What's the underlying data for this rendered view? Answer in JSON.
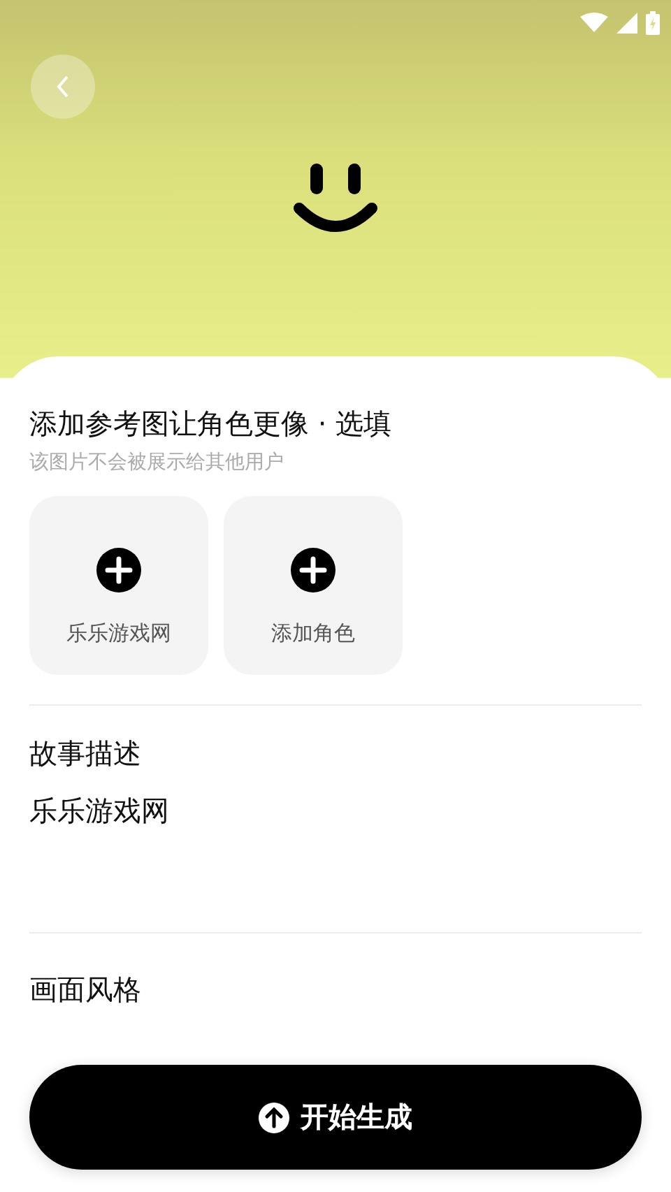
{
  "reference": {
    "title": "添加参考图让角色更像 · 选填",
    "subtitle": "该图片不会被展示给其他用户",
    "cards": [
      {
        "label": "乐乐游戏网"
      },
      {
        "label": "添加角色"
      }
    ]
  },
  "story": {
    "title": "故事描述",
    "value": "乐乐游戏网"
  },
  "style": {
    "title": "画面风格"
  },
  "generate_button": {
    "label": "开始生成"
  }
}
